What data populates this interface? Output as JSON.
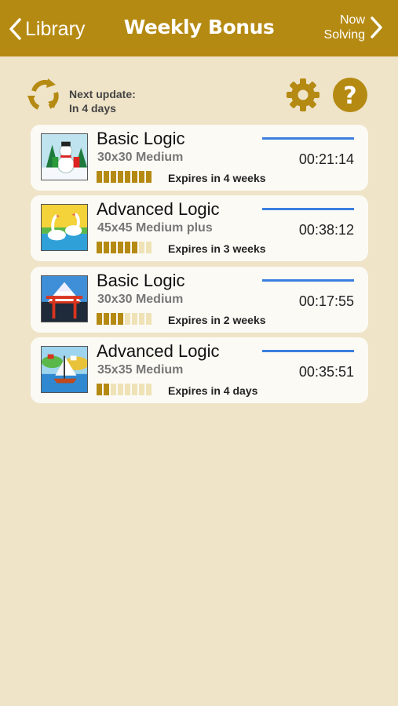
{
  "header": {
    "back_label": "Library",
    "title": "Weekly Bonus",
    "forward_label_line1": "Now",
    "forward_label_line2": "Solving"
  },
  "status": {
    "next_update_line1": "Next update:",
    "next_update_line2": "In 4 days"
  },
  "colors": {
    "header": "#b58a12",
    "background": "#efe4c8",
    "accent": "#b58a12",
    "progress_line": "#3b7ee0"
  },
  "puzzles": [
    {
      "title": "Basic Logic",
      "size": "30x30 Medium",
      "time": "00:21:14",
      "expires": "Expires in 4 weeks",
      "progress_filled": 8,
      "progress_total": 8,
      "thumbnail": "snowman-thumbnail"
    },
    {
      "title": "Advanced Logic",
      "size": "45x45 Medium plus",
      "time": "00:38:12",
      "expires": "Expires in 3 weeks",
      "progress_filled": 6,
      "progress_total": 8,
      "thumbnail": "swans-thumbnail"
    },
    {
      "title": "Basic Logic",
      "size": "30x30 Medium",
      "time": "00:17:55",
      "expires": "Expires in 2 weeks",
      "progress_filled": 4,
      "progress_total": 8,
      "thumbnail": "torii-gate-thumbnail"
    },
    {
      "title": "Advanced Logic",
      "size": "35x35 Medium",
      "time": "00:35:51",
      "expires": "Expires in 4 days",
      "progress_filled": 2,
      "progress_total": 8,
      "thumbnail": "sailboat-thumbnail"
    }
  ]
}
